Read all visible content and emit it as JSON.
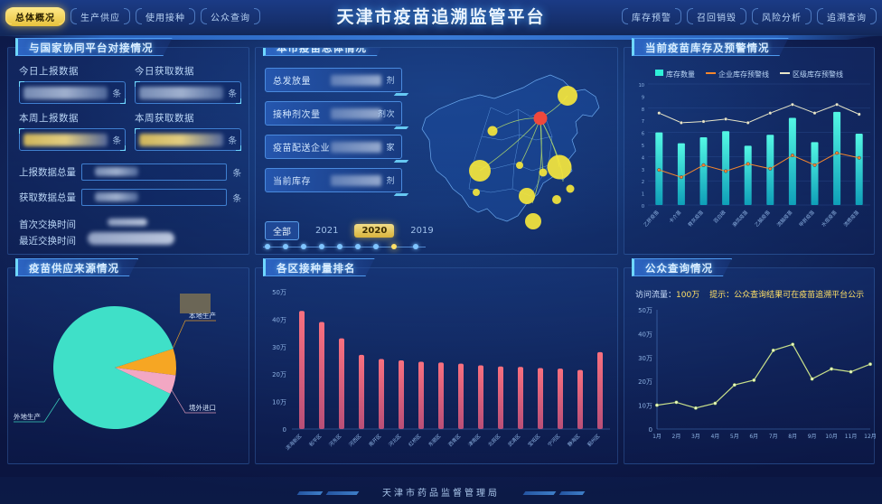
{
  "header": {
    "title": "天津市疫苗追溯监管平台",
    "nav_left": [
      {
        "label": "总体概况",
        "active": true
      },
      {
        "label": "生产供应",
        "active": false
      },
      {
        "label": "使用接种",
        "active": false
      },
      {
        "label": "公众查询",
        "active": false
      }
    ],
    "nav_right": [
      {
        "label": "库存预警",
        "active": false
      },
      {
        "label": "召回销毁",
        "active": false
      },
      {
        "label": "风险分析",
        "active": false
      },
      {
        "label": "追溯查询",
        "active": false
      }
    ]
  },
  "sync_panel": {
    "title": "与国家协同平台对接情况",
    "cards": [
      {
        "label": "今日上报数据",
        "unit": "条"
      },
      {
        "label": "今日获取数据",
        "unit": "条"
      },
      {
        "label": "本周上报数据",
        "unit": "条"
      },
      {
        "label": "本周获取数据",
        "unit": "条"
      }
    ],
    "rows": [
      {
        "label": "上报数据总量",
        "unit": "条"
      },
      {
        "label": "获取数据总量",
        "unit": "条"
      }
    ],
    "times": [
      {
        "label": "首次交换时间"
      },
      {
        "label": "最近交换时间"
      }
    ]
  },
  "overview_panel": {
    "title": "本市疫苗总体情况",
    "items": [
      {
        "label": "总发放量",
        "unit": "剂"
      },
      {
        "label": "接种剂次量",
        "unit": "剂次"
      },
      {
        "label": "疫苗配送企业",
        "unit": "家"
      },
      {
        "label": "当前库存",
        "unit": "剂"
      }
    ],
    "years": [
      {
        "label": "全部",
        "style": "box"
      },
      {
        "label": "2021",
        "style": "plain"
      },
      {
        "label": "2020",
        "style": "sel"
      },
      {
        "label": "2019",
        "style": "plain"
      }
    ],
    "map_name": "中国疫苗流向地图",
    "map_center_city": "天津"
  },
  "stock_panel": {
    "title": "当前疫苗库存及预警情况",
    "legend": [
      {
        "label": "库存数量",
        "type": "bar",
        "color": "#2ff0d8"
      },
      {
        "label": "企业库存预警线",
        "type": "line",
        "color": "#f5862d"
      },
      {
        "label": "区级库存预警线",
        "type": "line",
        "color": "#e8e6c8"
      }
    ]
  },
  "source_panel": {
    "title": "疫苗供应来源情况",
    "labels": [
      {
        "name": "本地生产",
        "color": "#f6a623"
      },
      {
        "name": "境外进口",
        "color": "#f2a7c3"
      },
      {
        "name": "外地生产",
        "color": "#3fe0c8"
      }
    ]
  },
  "rank_panel": {
    "title": "各区接种量排名"
  },
  "query_panel": {
    "title": "公众查询情况",
    "subtitle_prefix": "访问流量：",
    "subtitle_value": "100万",
    "note": "提示：公众查询结果可在疫苗追溯平台公示"
  },
  "footer": {
    "text": "天津市药品监督管理局"
  },
  "chart_data": [
    {
      "type": "bar",
      "name": "当前疫苗库存及预警情况",
      "title": "当前疫苗库存及预警情况",
      "xlabel": "",
      "ylabel": "",
      "ylim": [
        0,
        10
      ],
      "yticks": [
        0,
        1,
        2,
        3,
        4,
        5,
        6,
        7,
        8,
        9,
        10
      ],
      "grid": true,
      "legend_position": "top",
      "categories": [
        "乙肝疫苗",
        "卡介苗",
        "脊灰疫苗",
        "百白破",
        "麻风疫苗",
        "乙脑疫苗",
        "流脑疫苗",
        "甲肝疫苗",
        "水痘疫苗",
        "流感疫苗"
      ],
      "series": [
        {
          "name": "库存数量",
          "type": "bar",
          "color": "#2ff0d8",
          "values": [
            6.0,
            5.1,
            5.6,
            6.1,
            4.9,
            5.8,
            7.2,
            5.2,
            7.7,
            5.9
          ]
        },
        {
          "name": "企业库存预警线",
          "type": "line",
          "color": "#f5862d",
          "values": [
            2.9,
            2.3,
            3.3,
            2.8,
            3.4,
            3.0,
            4.1,
            3.3,
            4.3,
            3.9
          ]
        },
        {
          "name": "区级库存预警线",
          "type": "line",
          "color": "#e8e6c8",
          "values": [
            7.6,
            6.8,
            6.9,
            7.1,
            6.8,
            7.6,
            8.3,
            7.6,
            8.3,
            7.5
          ]
        }
      ]
    },
    {
      "type": "pie",
      "name": "疫苗供应来源情况",
      "title": "疫苗供应来源情况",
      "legend_position": "labels",
      "labels": [
        "外地生产",
        "本地生产",
        "境外进口"
      ],
      "values": [
        88,
        7,
        5
      ],
      "colors": [
        "#3fe0c8",
        "#f6a623",
        "#f2a7c3"
      ]
    },
    {
      "type": "bar",
      "name": "各区接种量排名",
      "title": "各区接种量排名",
      "xlabel": "",
      "ylabel": "",
      "ylim": [
        0,
        500000
      ],
      "ytick_labels": [
        "0",
        "10万",
        "20万",
        "30万",
        "40万",
        "50万"
      ],
      "yticks": [
        0,
        100000,
        200000,
        300000,
        400000,
        500000
      ],
      "grid": false,
      "categories": [
        "滨海新区",
        "和平区",
        "河东区",
        "河西区",
        "南开区",
        "河北区",
        "红桥区",
        "东丽区",
        "西青区",
        "津南区",
        "北辰区",
        "武清区",
        "宝坻区",
        "宁河区",
        "静海区",
        "蓟州区"
      ],
      "values": [
        430000,
        390000,
        330000,
        270000,
        255000,
        250000,
        245000,
        242000,
        238000,
        232000,
        228000,
        226000,
        222000,
        220000,
        215000,
        280000
      ],
      "color": "#f2677a"
    },
    {
      "type": "line",
      "name": "公众查询情况",
      "title": "公众查询情况",
      "xlabel": "",
      "ylabel": "",
      "ylim": [
        0,
        500000
      ],
      "ytick_labels": [
        "0",
        "10万",
        "20万",
        "30万",
        "40万",
        "50万"
      ],
      "yticks": [
        0,
        100000,
        200000,
        300000,
        400000,
        500000
      ],
      "grid": false,
      "categories": [
        "1月",
        "2月",
        "3月",
        "4月",
        "5月",
        "6月",
        "7月",
        "8月",
        "9月",
        "10月",
        "11月",
        "12月"
      ],
      "values": [
        100000,
        112000,
        88000,
        108000,
        185000,
        205000,
        330000,
        355000,
        210000,
        252000,
        240000,
        272000
      ],
      "color": "#c8e08a"
    }
  ]
}
